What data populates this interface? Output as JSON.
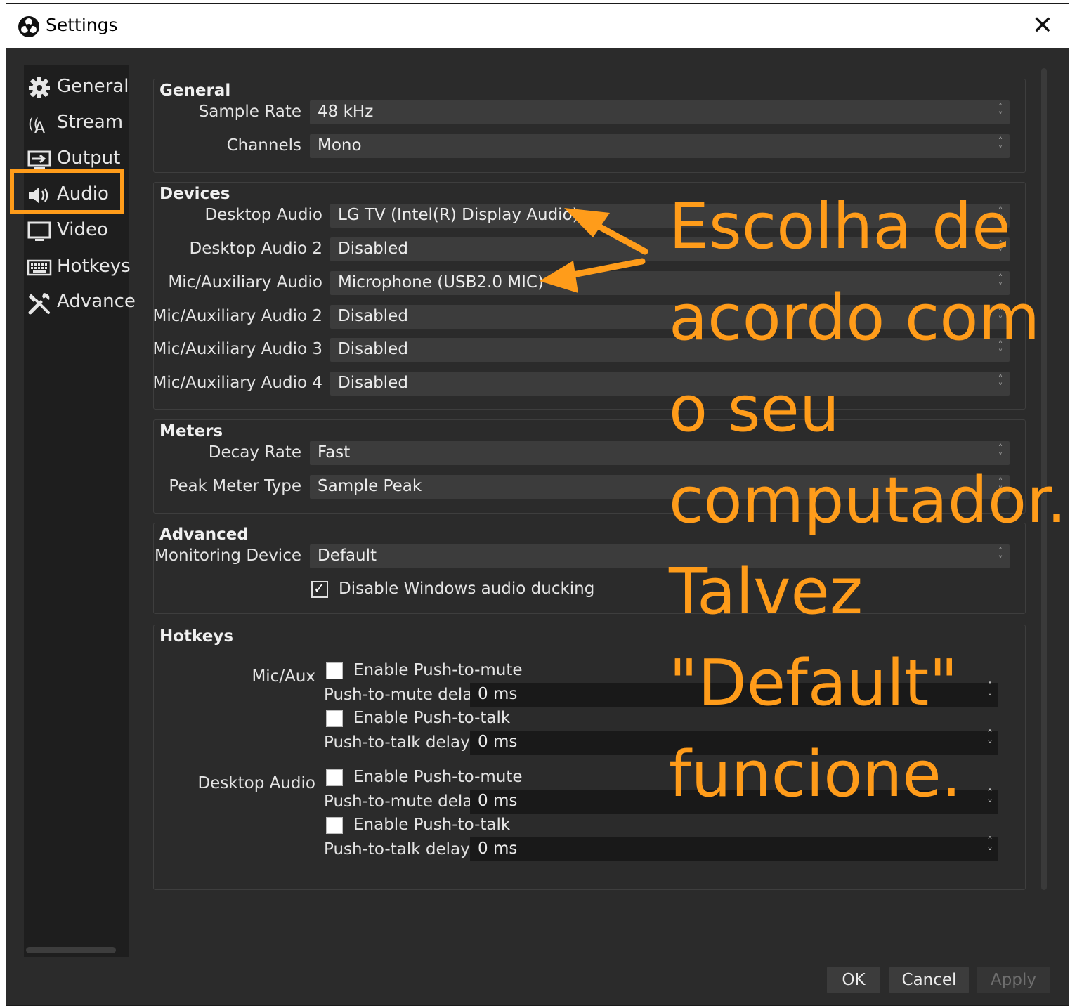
{
  "window": {
    "title": "Settings"
  },
  "sidebar": {
    "items": [
      {
        "label": "General",
        "icon": "gear-icon"
      },
      {
        "label": "Stream",
        "icon": "antenna-icon"
      },
      {
        "label": "Output",
        "icon": "output-icon"
      },
      {
        "label": "Audio",
        "icon": "speaker-icon",
        "selected": true
      },
      {
        "label": "Video",
        "icon": "monitor-icon"
      },
      {
        "label": "Hotkeys",
        "icon": "keyboard-icon"
      },
      {
        "label": "Advance",
        "icon": "tools-icon"
      }
    ]
  },
  "general": {
    "title": "General",
    "sample_rate_label": "Sample Rate",
    "sample_rate_value": "48 kHz",
    "channels_label": "Channels",
    "channels_value": "Mono"
  },
  "devices": {
    "title": "Devices",
    "rows": [
      {
        "label": "Desktop Audio",
        "value": "LG TV (Intel(R) Display Audio)"
      },
      {
        "label": "Desktop Audio 2",
        "value": "Disabled"
      },
      {
        "label": "Mic/Auxiliary Audio",
        "value": "Microphone (USB2.0 MIC)"
      },
      {
        "label": "Mic/Auxiliary Audio 2",
        "value": "Disabled"
      },
      {
        "label": "Mic/Auxiliary Audio 3",
        "value": "Disabled"
      },
      {
        "label": "Mic/Auxiliary Audio 4",
        "value": "Disabled"
      }
    ]
  },
  "meters": {
    "title": "Meters",
    "decay_label": "Decay Rate",
    "decay_value": "Fast",
    "peak_label": "Peak Meter Type",
    "peak_value": "Sample Peak"
  },
  "advanced": {
    "title": "Advanced",
    "monitoring_label": "Monitoring Device",
    "monitoring_value": "Default",
    "ducking_label": "Disable Windows audio ducking",
    "ducking_checked": true
  },
  "hotkeys": {
    "title": "Hotkeys",
    "sources": [
      {
        "name": "Mic/Aux",
        "push_to_mute_label": "Enable Push-to-mute",
        "push_to_mute_delay_label": "Push-to-mute delay",
        "push_to_mute_delay_value": "0 ms",
        "push_to_talk_label": "Enable Push-to-talk",
        "push_to_talk_delay_label": "Push-to-talk delay",
        "push_to_talk_delay_value": "0 ms"
      },
      {
        "name": "Desktop Audio",
        "push_to_mute_label": "Enable Push-to-mute",
        "push_to_mute_delay_label": "Push-to-mute delay",
        "push_to_mute_delay_value": "0 ms",
        "push_to_talk_label": "Enable Push-to-talk",
        "push_to_talk_delay_label": "Push-to-talk delay",
        "push_to_talk_delay_value": "0 ms"
      }
    ]
  },
  "buttons": {
    "ok": "OK",
    "cancel": "Cancel",
    "apply": "Apply"
  },
  "annotation": {
    "text": "Escolha de\nacordo com\no seu\ncomputador.\nTalvez\n\"Default\"\nfuncione.",
    "color": "#ff9c1a"
  },
  "colors": {
    "accent": "#ff9c1a",
    "background": "#2b2b2b",
    "sidebar": "#1e1e1e"
  }
}
